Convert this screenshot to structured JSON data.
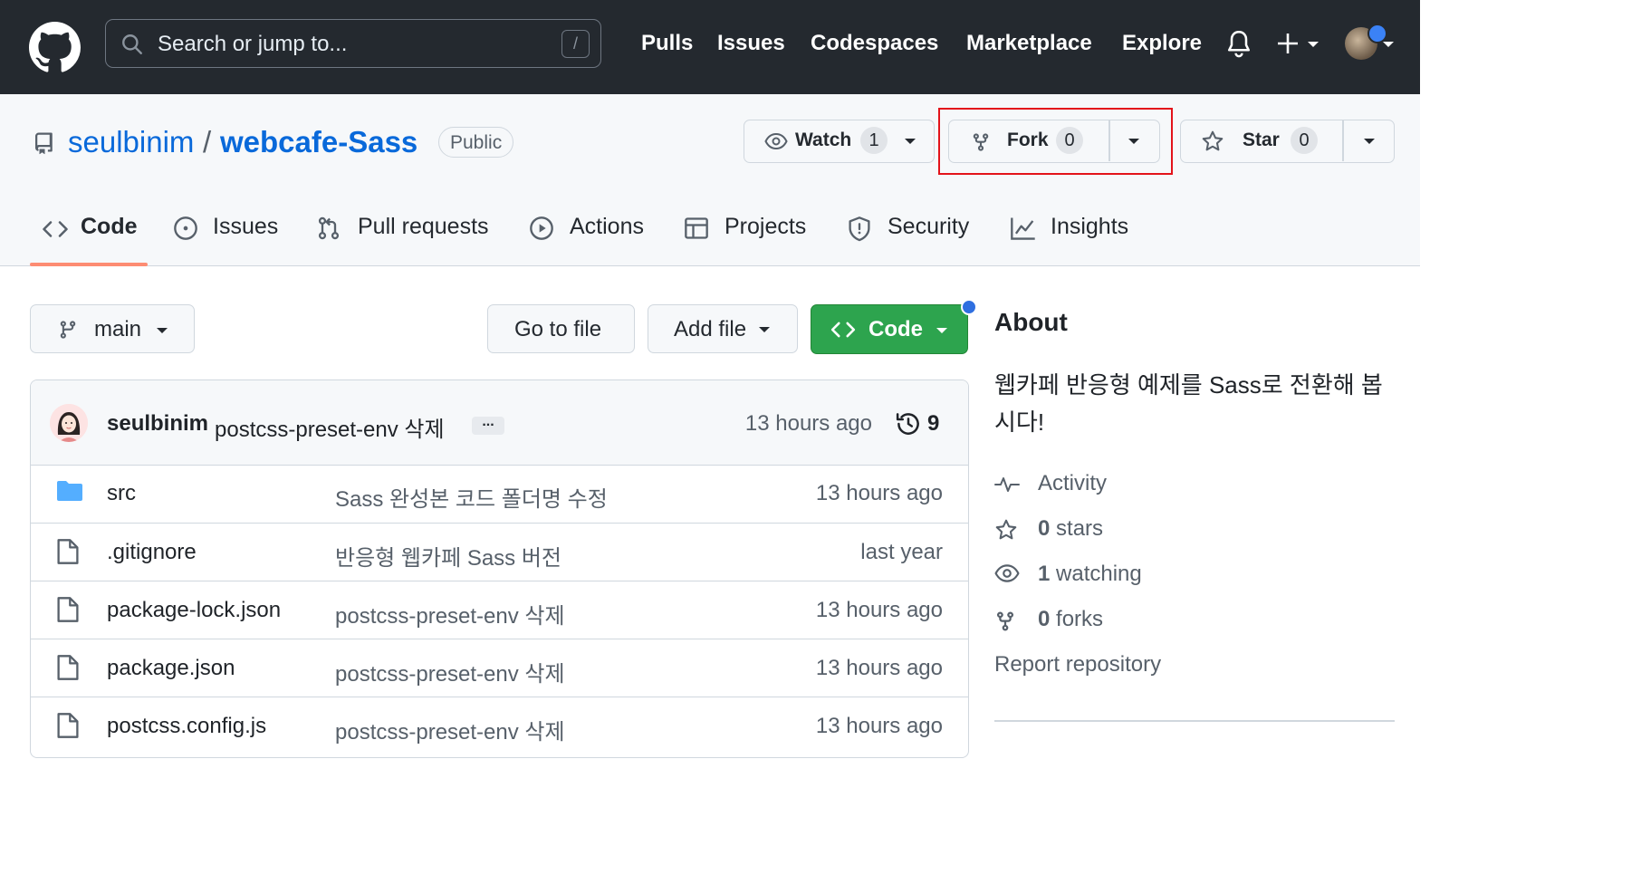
{
  "header": {
    "search_placeholder": "Search or jump to...",
    "search_shortcut": "/",
    "nav": [
      "Pulls",
      "Issues",
      "Codespaces",
      "Marketplace",
      "Explore"
    ]
  },
  "repo": {
    "owner": "seulbinim",
    "separator": "/",
    "name": "webcafe-Sass",
    "visibility": "Public",
    "watch": {
      "label": "Watch",
      "count": "1"
    },
    "fork": {
      "label": "Fork",
      "count": "0"
    },
    "star": {
      "label": "Star",
      "count": "0"
    },
    "highlight_color": "#e3131a"
  },
  "tabs": [
    {
      "label": "Code",
      "icon": "code-icon",
      "active": true
    },
    {
      "label": "Issues",
      "icon": "issue-icon"
    },
    {
      "label": "Pull requests",
      "icon": "pull-request-icon"
    },
    {
      "label": "Actions",
      "icon": "play-icon"
    },
    {
      "label": "Projects",
      "icon": "table-icon"
    },
    {
      "label": "Security",
      "icon": "shield-icon"
    },
    {
      "label": "Insights",
      "icon": "graph-icon"
    }
  ],
  "toolbar": {
    "branch": "main",
    "go_to_file": "Go to file",
    "add_file": "Add file",
    "code": "Code"
  },
  "commit": {
    "author": "seulbinim",
    "message": "postcss-preset-env 삭제",
    "ellipsis": "...",
    "time": "13 hours ago",
    "count": "9"
  },
  "files": [
    {
      "type": "folder",
      "name": "src",
      "message": "Sass 완성본 코드 폴더명 수정",
      "time": "13 hours ago"
    },
    {
      "type": "file",
      "name": ".gitignore",
      "message": "반응형 웹카페 Sass 버전",
      "time": "last year"
    },
    {
      "type": "file",
      "name": "package-lock.json",
      "message": "postcss-preset-env 삭제",
      "time": "13 hours ago"
    },
    {
      "type": "file",
      "name": "package.json",
      "message": "postcss-preset-env 삭제",
      "time": "13 hours ago"
    },
    {
      "type": "file",
      "name": "postcss.config.js",
      "message": "postcss-preset-env 삭제",
      "time": "13 hours ago"
    }
  ],
  "about": {
    "title": "About",
    "description": "웹카페 반응형 예제를 Sass로 전환해 봅시다!",
    "activity": "Activity",
    "stars_count": "0",
    "stars_label": "stars",
    "watching_count": "1",
    "watching_label": "watching",
    "forks_count": "0",
    "forks_label": "forks",
    "report": "Report repository"
  }
}
